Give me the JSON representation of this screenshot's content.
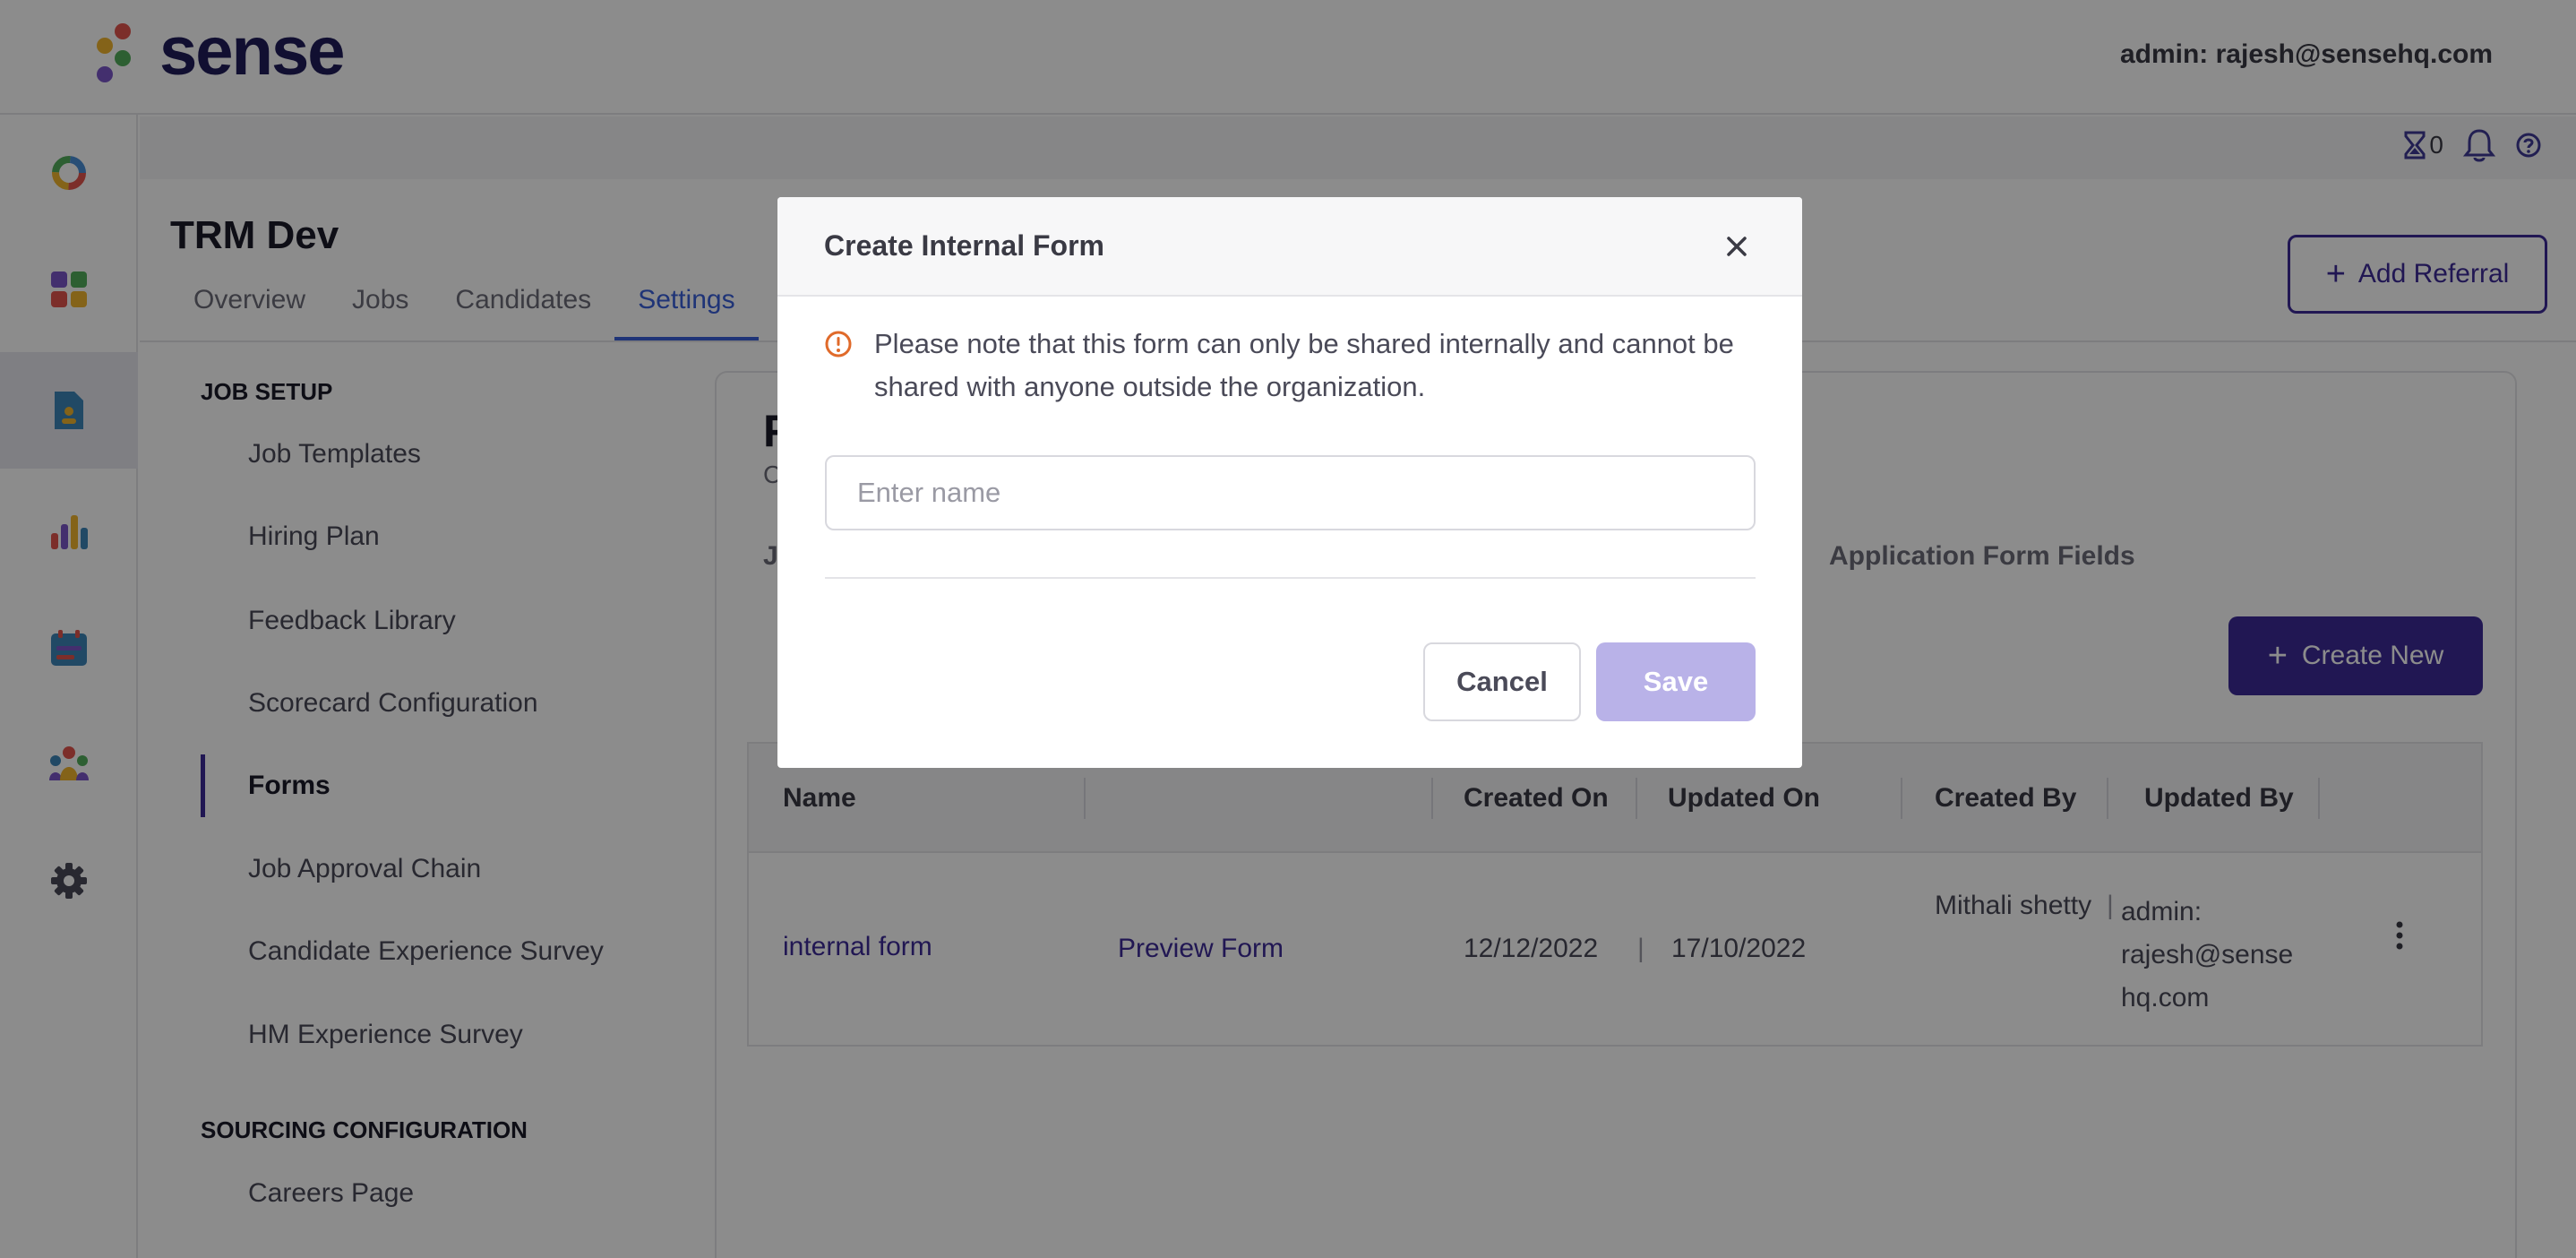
{
  "brand": {
    "name": "sense"
  },
  "header": {
    "user_label": "admin: rajesh@sensehq.com"
  },
  "rail": {
    "icons": [
      "sense-donut-icon",
      "dashboard-icon",
      "jobs-document-icon",
      "analytics-icon",
      "calendar-icon",
      "team-icon",
      "gear-icon"
    ]
  },
  "strip": {
    "pending_count": "0"
  },
  "page": {
    "org_title": "TRM Dev",
    "tabs": [
      {
        "label": "Overview"
      },
      {
        "label": "Jobs"
      },
      {
        "label": "Candidates"
      },
      {
        "label": "Settings"
      }
    ],
    "add_referral_label": "Add Referral"
  },
  "settings_nav": {
    "job_setup_heading": "JOB SETUP",
    "items": [
      {
        "label": "Job Templates"
      },
      {
        "label": "Hiring Plan"
      },
      {
        "label": "Feedback Library"
      },
      {
        "label": "Scorecard Configuration"
      },
      {
        "label": "Forms"
      },
      {
        "label": "Job Approval Chain"
      },
      {
        "label": "Candidate Experience Survey"
      },
      {
        "label": "HM Experience Survey"
      }
    ],
    "sourcing_heading": "SOURCING CONFIGURATION",
    "sourcing_items": [
      {
        "label": "Careers Page"
      }
    ]
  },
  "main": {
    "title": "F",
    "subtitle": "C",
    "subtab_left": "J",
    "subtab_right": "Application Form Fields",
    "create_new_label": "Create New",
    "table": {
      "columns": [
        "Name",
        "Created On",
        "Updated On",
        "Created By",
        "Updated By"
      ],
      "rows": [
        {
          "name": "internal form",
          "preview": "Preview Form",
          "created_on": "12/12/2022",
          "updated_on": "17/10/2022",
          "created_by": "Mithali shetty",
          "updated_by_line1": "admin:",
          "updated_by_line2": "rajesh@sense",
          "updated_by_line3": "hq.com"
        }
      ]
    }
  },
  "modal": {
    "title": "Create Internal Form",
    "notice_line1": "Please note that this form can only be shared internally and cannot be",
    "notice_line2": "shared with anyone outside the organization.",
    "name_placeholder": "Enter name",
    "name_value": "",
    "cancel_label": "Cancel",
    "save_label": "Save"
  },
  "colors": {
    "brand_primary": "#3c2a98",
    "link": "#3a5fd9",
    "warning": "#e06a2a",
    "save_disabled": "#b9b2e8"
  }
}
